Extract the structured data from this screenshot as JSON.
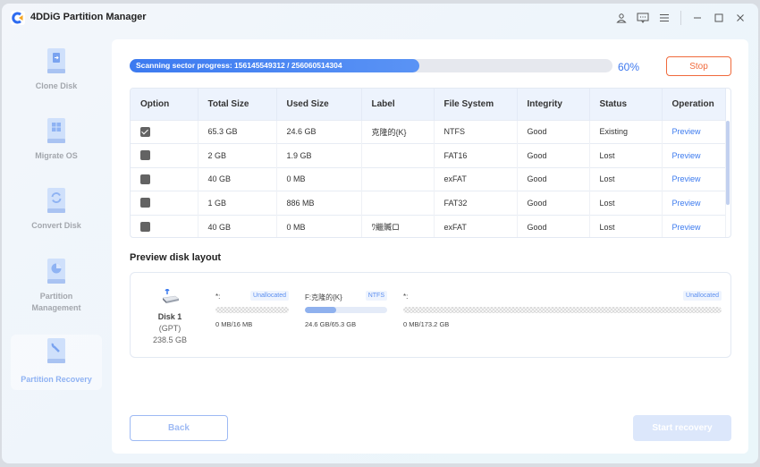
{
  "app": {
    "title": "4DDiG Partition Manager",
    "titlebar_icons": [
      "user-icon",
      "feedback-icon",
      "menu-icon",
      "minimize-icon",
      "maximize-icon",
      "close-icon"
    ]
  },
  "sidebar": {
    "items": [
      {
        "label": "Clone Disk",
        "icon": "clone-disk-icon",
        "active": false
      },
      {
        "label": "Migrate OS",
        "icon": "migrate-os-icon",
        "active": false
      },
      {
        "label": "Convert Disk",
        "icon": "convert-disk-icon",
        "active": false
      },
      {
        "label": "Partition Management",
        "icon": "partition-management-icon",
        "active": false
      },
      {
        "label": "Partition Recovery",
        "icon": "partition-recovery-icon",
        "active": true
      }
    ]
  },
  "scan": {
    "progress_text": "Scanning sector progress: 156145549312 / 256060514304",
    "percent_label": "60%",
    "percent": 60,
    "stop_label": "Stop"
  },
  "table": {
    "headers": [
      "Option",
      "Total Size",
      "Used Size",
      "Label",
      "File System",
      "Integrity",
      "Status",
      "Operation"
    ],
    "rows": [
      {
        "checked": true,
        "total": "65.3 GB",
        "used": "24.6 GB",
        "label": "克隆的{K}",
        "fs": "NTFS",
        "integrity": "Good",
        "status": "Existing",
        "operation": "Preview"
      },
      {
        "checked": false,
        "total": "2 GB",
        "used": "1.9 GB",
        "label": "",
        "fs": "FAT16",
        "integrity": "Good",
        "status": "Lost",
        "operation": "Preview"
      },
      {
        "checked": false,
        "total": "40 GB",
        "used": "0 MB",
        "label": "",
        "fs": "exFAT",
        "integrity": "Good",
        "status": "Lost",
        "operation": "Preview"
      },
      {
        "checked": false,
        "total": "1 GB",
        "used": "886 MB",
        "label": "",
        "fs": "FAT32",
        "integrity": "Good",
        "status": "Lost",
        "operation": "Preview"
      },
      {
        "checked": false,
        "total": "40 GB",
        "used": "0 MB",
        "label": "ﾜ繼贓ロ",
        "fs": "exFAT",
        "integrity": "Good",
        "status": "Lost",
        "operation": "Preview"
      }
    ]
  },
  "disk_layout": {
    "title": "Preview disk layout",
    "disk": {
      "name": "Disk 1",
      "type": "(GPT)",
      "size": "238.5 GB"
    },
    "partitions": [
      {
        "name": "*:",
        "tag": "Unallocated",
        "size_text": "0 MB/16 MB",
        "used_fraction": 0,
        "style": "hatch"
      },
      {
        "name": "F:克隆的{K}",
        "tag": "NTFS",
        "size_text": "24.6 GB/65.3 GB",
        "used_fraction": 0.377,
        "style": "solid"
      },
      {
        "name": "*:",
        "tag": "Unallocated",
        "size_text": "0 MB/173.2 GB",
        "used_fraction": 0,
        "style": "hatch"
      }
    ]
  },
  "footer": {
    "back_label": "Back",
    "start_label": "Start recovery"
  },
  "colors": {
    "accent": "#3d78ee",
    "stop": "#f06a3c",
    "progress": "#3c7af0"
  }
}
